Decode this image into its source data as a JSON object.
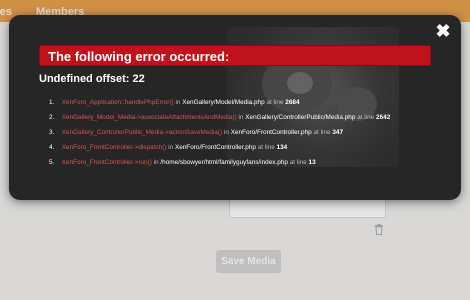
{
  "nav": {
    "item1": "tes",
    "item2": "Members"
  },
  "page": {
    "save_label": "Save Media"
  },
  "dialog": {
    "title": "The following error occurred:",
    "message": "Undefined offset: 22",
    "in_word": "in",
    "at_line_word": "at line",
    "trace": [
      {
        "num": "1.",
        "fn": "XenForo_Application::handlePhpError()",
        "path": "XenGallery/Model/Media.php",
        "line": "2684"
      },
      {
        "num": "2.",
        "fn": "XenGallery_Model_Media->associateAttachmentsAndMedia()",
        "path": "XenGallery/ControllerPublic/Media.php",
        "line": "2642"
      },
      {
        "num": "3.",
        "fn": "XenGallery_ControllerPublic_Media->actionSaveMedia()",
        "path": "XenForo/FrontController.php",
        "line": "347"
      },
      {
        "num": "4.",
        "fn": "XenForo_FrontController->dispatch()",
        "path": "XenForo/FrontController.php",
        "line": "134"
      },
      {
        "num": "5.",
        "fn": "XenForo_FrontController->run()",
        "path": "/home/sbowyer/html/familyguyfans/index.php",
        "line": "13"
      }
    ]
  }
}
